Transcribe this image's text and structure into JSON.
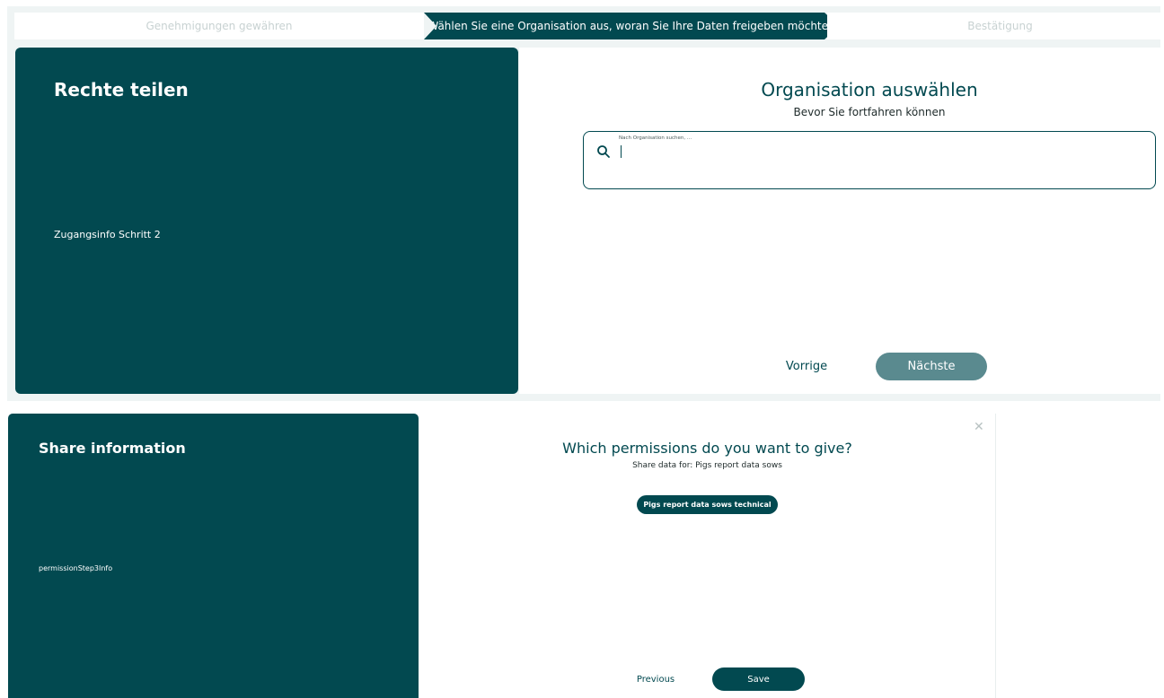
{
  "top": {
    "stepper": {
      "steps": [
        {
          "label": "Genehmigungen gewähren",
          "state": "inactive"
        },
        {
          "label": "Wählen Sie eine Organisation aus, woran Sie Ihre Daten freigeben möchten",
          "state": "active"
        },
        {
          "label": "Bestätigung",
          "state": "inactive"
        }
      ]
    },
    "info_card": {
      "title": "Rechte teilen",
      "info": "Zugangsinfo Schritt 2"
    },
    "main": {
      "title": "Organisation auswählen",
      "subtitle": "Bevor Sie fortfahren können",
      "search": {
        "label": "Nach Organisation suchen, ...",
        "value": "",
        "icon": "search-icon"
      },
      "previous_label": "Vorrige",
      "next_label": "Nächste"
    }
  },
  "bottom": {
    "info_card": {
      "title": "Share information",
      "info": "permissionStep3Info"
    },
    "main": {
      "close_glyph": "✕",
      "title": "Which permissions do you want to give?",
      "subtitle": "Share data for: Pigs report data sows",
      "chip_label": "Pigs report data sows technical",
      "previous_label": "Previous",
      "save_label": "Save"
    }
  },
  "colors": {
    "primary": "#024950",
    "button_disabled": "#5a8a8f",
    "background": "#eff4f4"
  }
}
